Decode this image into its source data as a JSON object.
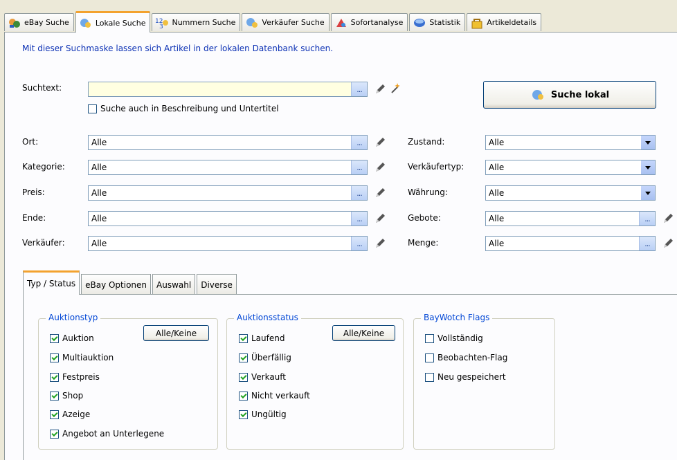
{
  "tabs": [
    {
      "label": "eBay Suche",
      "icon": "ebay-search-icon",
      "active": false
    },
    {
      "label": "Lokale Suche",
      "icon": "local-search-icon",
      "active": true
    },
    {
      "label": "Nummern Suche",
      "icon": "number-search-icon",
      "active": false
    },
    {
      "label": "Verkäufer Suche",
      "icon": "seller-search-icon",
      "active": false
    },
    {
      "label": "Sofortanalyse",
      "icon": "analysis-icon",
      "active": false
    },
    {
      "label": "Statistik",
      "icon": "statistics-icon",
      "active": false
    },
    {
      "label": "Artikeldetails",
      "icon": "article-details-icon",
      "active": false
    }
  ],
  "intro": "Mit dieser Suchmaske lassen sich Artikel in der lokalen Datenbank suchen.",
  "search": {
    "label": "Suchtext:",
    "value": "",
    "dots": "...",
    "desc_check": "Suche auch in Beschreibung und Untertitel",
    "desc_checked": false,
    "button": "Suche lokal"
  },
  "left_fields": [
    {
      "label": "Ort:",
      "value": "Alle"
    },
    {
      "label": "Kategorie:",
      "value": "Alle"
    },
    {
      "label": "Preis:",
      "value": "Alle"
    },
    {
      "label": "Ende:",
      "value": "Alle"
    },
    {
      "label": "Verkäufer:",
      "value": "Alle"
    }
  ],
  "right_fields": [
    {
      "label": "Zustand:",
      "value": "Alle",
      "type": "dropdown"
    },
    {
      "label": "Verkäufertyp:",
      "value": "Alle",
      "type": "dropdown"
    },
    {
      "label": "Währung:",
      "value": "Alle",
      "type": "dropdown"
    },
    {
      "label": "Gebote:",
      "value": "Alle",
      "type": "dots"
    },
    {
      "label": "Menge:",
      "value": "Alle",
      "type": "dots"
    }
  ],
  "subtabs": [
    "Typ / Status",
    "eBay Optionen",
    "Auswahl",
    "Diverse"
  ],
  "groups": {
    "auktionstyp": {
      "title": "Auktionstyp",
      "button": "Alle/Keine",
      "items": [
        {
          "label": "Auktion",
          "checked": true
        },
        {
          "label": "Multiauktion",
          "checked": true
        },
        {
          "label": "Festpreis",
          "checked": true
        },
        {
          "label": "Shop",
          "checked": true
        },
        {
          "label": "Azeige",
          "checked": true
        },
        {
          "label": "Angebot an Unterlegene",
          "checked": true
        }
      ]
    },
    "auktionsstatus": {
      "title": "Auktionsstatus",
      "button": "Alle/Keine",
      "items": [
        {
          "label": "Laufend",
          "checked": true
        },
        {
          "label": "Überfällig",
          "checked": true
        },
        {
          "label": "Verkauft",
          "checked": true
        },
        {
          "label": "Nicht verkauft",
          "checked": true
        },
        {
          "label": "Ungültig",
          "checked": true
        }
      ]
    },
    "flags": {
      "title": "BayWotch Flags",
      "items": [
        {
          "label": "Vollständig",
          "checked": false
        },
        {
          "label": "Beobachten-Flag",
          "checked": false
        },
        {
          "label": "Neu gespeichert",
          "checked": false
        }
      ]
    }
  },
  "colors": {
    "accent": "#f3a22f",
    "link": "#0b30b4",
    "group_title": "#0046d5",
    "field_border": "#7f9db9"
  }
}
